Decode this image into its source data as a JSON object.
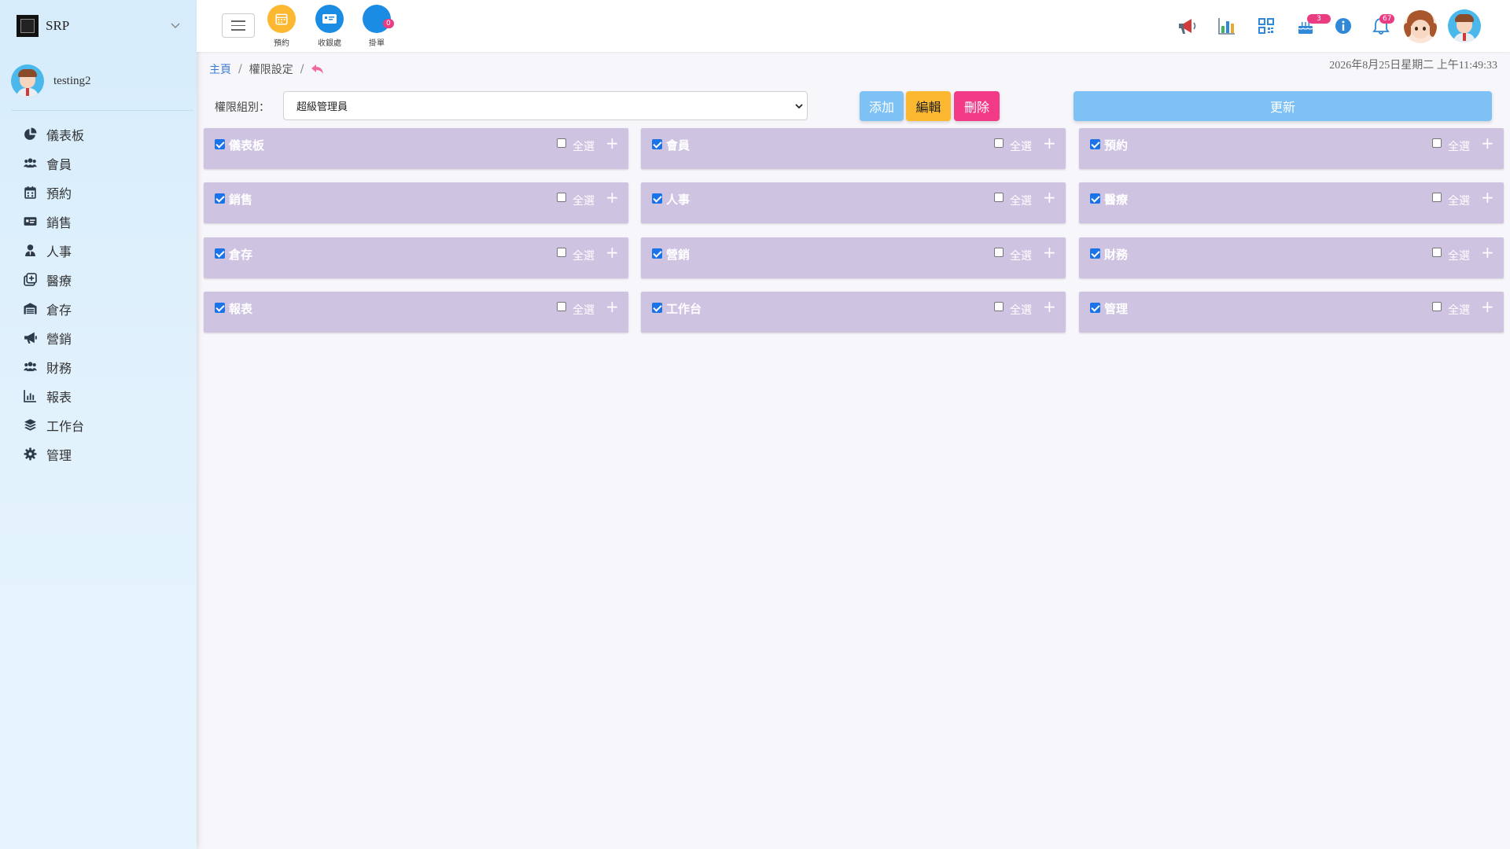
{
  "app": {
    "brand": "SRP",
    "user_name": "testing2"
  },
  "sidebar": {
    "items": [
      {
        "label": "儀表板",
        "icon": "pie-chart-icon"
      },
      {
        "label": "會員",
        "icon": "users-icon"
      },
      {
        "label": "預約",
        "icon": "calendar-icon"
      },
      {
        "label": "銷售",
        "icon": "money-card-icon"
      },
      {
        "label": "人事",
        "icon": "user-tie-icon"
      },
      {
        "label": "醫療",
        "icon": "medical-icon"
      },
      {
        "label": "倉存",
        "icon": "warehouse-icon"
      },
      {
        "label": "營銷",
        "icon": "megaphone-icon"
      },
      {
        "label": "財務",
        "icon": "users-icon"
      },
      {
        "label": "報表",
        "icon": "bar-chart-icon"
      },
      {
        "label": "工作台",
        "icon": "layers-icon"
      },
      {
        "label": "管理",
        "icon": "gear-icon"
      }
    ]
  },
  "topbar": {
    "quick": [
      {
        "label": "預約",
        "color": "#fbb830",
        "icon": "calendar-icon"
      },
      {
        "label": "收銀處",
        "color": "#1b8ce3",
        "icon": "cash-register-icon"
      },
      {
        "label": "掛單",
        "color": "#1b8ce3",
        "icon": "pending-order-icon",
        "badge": "0"
      }
    ],
    "cake_badge": "3",
    "bell_badge": "67"
  },
  "breadcrumb": {
    "home": "主頁",
    "sep": "/",
    "current": "權限設定"
  },
  "datetime": "2026年8月25日星期二 上午11:49:33",
  "filter": {
    "label": "權限組別：",
    "selected": "超級管理員"
  },
  "buttons": {
    "add": "添加",
    "edit": "編輯",
    "delete": "刪除",
    "update": "更新"
  },
  "select_all_label": "全選",
  "modules": [
    {
      "name": "儀表板",
      "checked": true
    },
    {
      "name": "會員",
      "checked": true
    },
    {
      "name": "預約",
      "checked": true
    },
    {
      "name": "銷售",
      "checked": true
    },
    {
      "name": "人事",
      "checked": true
    },
    {
      "name": "醫療",
      "checked": true
    },
    {
      "name": "倉存",
      "checked": true
    },
    {
      "name": "營銷",
      "checked": true
    },
    {
      "name": "財務",
      "checked": true
    },
    {
      "name": "報表",
      "checked": true
    },
    {
      "name": "工作台",
      "checked": true
    },
    {
      "name": "管理",
      "checked": true
    }
  ]
}
